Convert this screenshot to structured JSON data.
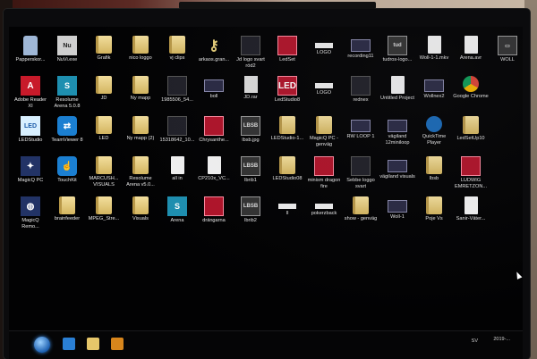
{
  "desktop": {
    "rows": [
      [
        {
          "label": "Papperskor...",
          "icon": "recycle-bin-icon",
          "kind": "k-bin"
        },
        {
          "label": "NuVi.exe",
          "icon": "nuvi-app-icon",
          "kind": "k-nu",
          "glyph": "Nu"
        },
        {
          "label": "Grafik",
          "icon": "folder-icon",
          "kind": "k-folder"
        },
        {
          "label": "nico loggo",
          "icon": "folder-icon",
          "kind": "k-folder"
        },
        {
          "label": "vj clips",
          "icon": "folder-icon",
          "kind": "k-folder"
        },
        {
          "label": "arkaos.gran...",
          "icon": "key-icon",
          "kind": "k-key",
          "glyph": "⚷"
        },
        {
          "label": "Jd logo svart röd2",
          "icon": "logo-image-icon",
          "kind": "k-dark"
        },
        {
          "label": "LedSet",
          "icon": "ledset-app-icon",
          "kind": "k-red"
        },
        {
          "label": "LOGO",
          "icon": "logo-image-icon",
          "kind": "k-bar"
        },
        {
          "label": "recording11",
          "icon": "video-file-icon",
          "kind": "k-vid"
        },
        {
          "label": "tudros-logo...",
          "icon": "logo-image-icon",
          "kind": "k-laser",
          "glyph": "tud"
        },
        {
          "label": "Woll-1-1.mkv",
          "icon": "document-icon",
          "kind": "k-doc"
        },
        {
          "label": "Arena.avr",
          "icon": "document-icon",
          "kind": "k-doc"
        },
        {
          "label": "WOLL",
          "icon": "monitor-image-icon",
          "kind": "k-laser",
          "glyph": "▭"
        }
      ],
      [
        {
          "label": "Adobe Reader XI",
          "icon": "adobe-reader-icon",
          "kind": "k-ps",
          "glyph": "A"
        },
        {
          "label": "Resolume Arena 5.0.8",
          "icon": "resolume-arena-icon",
          "kind": "k-ar",
          "glyph": "S"
        },
        {
          "label": "JD",
          "icon": "folder-icon",
          "kind": "k-folder"
        },
        {
          "label": "Ny mapp",
          "icon": "folder-icon",
          "kind": "k-folder"
        },
        {
          "label": "1985506_54...",
          "icon": "photo-icon",
          "kind": "k-dark"
        },
        {
          "label": "boll",
          "icon": "video-file-icon",
          "kind": "k-vid"
        },
        {
          "label": "JD.rar",
          "icon": "document-icon",
          "kind": "k-file"
        },
        {
          "label": "LedStudio8",
          "icon": "ledstudio-icon",
          "kind": "k-red",
          "glyph": "LED"
        },
        {
          "label": "LOGO",
          "icon": "logo-image-icon",
          "kind": "k-bar"
        },
        {
          "label": "rednex",
          "icon": "photo-icon",
          "kind": "k-dark"
        },
        {
          "label": "Untitled Project",
          "icon": "project-file-icon",
          "kind": "k-doc"
        },
        {
          "label": "Wollnex2",
          "icon": "video-file-icon",
          "kind": "k-vid"
        },
        {
          "label": "Google Chrome",
          "icon": "chrome-icon",
          "kind": "k-chrome"
        }
      ],
      [
        {
          "label": "LEDStudio",
          "icon": "ledstudio-icon",
          "kind": "k-led",
          "glyph": "LED"
        },
        {
          "label": "TeamViewer 8",
          "icon": "teamviewer-icon",
          "kind": "k-tv",
          "glyph": "⇄"
        },
        {
          "label": "LED",
          "icon": "folder-icon",
          "kind": "k-folder"
        },
        {
          "label": "Ny mapp (2)",
          "icon": "folder-icon",
          "kind": "k-folder"
        },
        {
          "label": "15318642_10...",
          "icon": "photo-icon",
          "kind": "k-dark"
        },
        {
          "label": "Chrysanthe...",
          "icon": "photo-icon",
          "kind": "k-red"
        },
        {
          "label": "lbsb.jpg",
          "icon": "photo-icon",
          "kind": "k-laser",
          "glyph": "LBSB"
        },
        {
          "label": "LEDStudio-1...",
          "icon": "folder-icon",
          "kind": "k-folder"
        },
        {
          "label": "MagicQ PC - genväg",
          "icon": "folder-icon",
          "kind": "k-folder"
        },
        {
          "label": "RW LOOP 1",
          "icon": "video-file-icon",
          "kind": "k-vid"
        },
        {
          "label": "vägiland 12miniloop",
          "icon": "video-file-icon",
          "kind": "k-vid"
        },
        {
          "label": "QuickTime Player",
          "icon": "quicktime-icon",
          "kind": "k-qt"
        },
        {
          "label": "LedSetUp10",
          "icon": "folder-icon",
          "kind": "k-folder"
        }
      ],
      [
        {
          "label": "MagicQ PC",
          "icon": "magicq-icon",
          "kind": "k-magic",
          "glyph": "✦"
        },
        {
          "label": "TouchKit",
          "icon": "touchkit-icon",
          "kind": "k-tv",
          "glyph": "☝"
        },
        {
          "label": "MARCUSH... VISUALS",
          "icon": "folder-icon",
          "kind": "k-folder"
        },
        {
          "label": "Resolume Arena v5.0...",
          "icon": "folder-icon",
          "kind": "k-folder"
        },
        {
          "label": "all in",
          "icon": "document-icon",
          "kind": "k-doc"
        },
        {
          "label": "CP210x_VC...",
          "icon": "document-icon",
          "kind": "k-doc"
        },
        {
          "label": "lbrib1",
          "icon": "photo-icon",
          "kind": "k-laser",
          "glyph": "LBSB"
        },
        {
          "label": "LEDStudio08",
          "icon": "folder-icon",
          "kind": "k-folder"
        },
        {
          "label": "minism dragon fire",
          "icon": "video-file-icon",
          "kind": "k-red"
        },
        {
          "label": "Sebbe loggo svart",
          "icon": "photo-icon",
          "kind": "k-dark"
        },
        {
          "label": "vägiland visuals",
          "icon": "video-file-icon",
          "kind": "k-vid"
        },
        {
          "label": "lbsb",
          "icon": "folder-icon",
          "kind": "k-folder"
        },
        {
          "label": "LUDWIG EMRETZON...",
          "icon": "photo-icon",
          "kind": "k-red"
        }
      ],
      [
        {
          "label": "MagicQ Remo...",
          "icon": "magicq-remote-icon",
          "kind": "k-magic",
          "glyph": "◍"
        },
        {
          "label": "brainfeeder",
          "icon": "folder-icon",
          "kind": "k-folder"
        },
        {
          "label": "MPEG_Stre...",
          "icon": "folder-icon",
          "kind": "k-folder"
        },
        {
          "label": "Visuals",
          "icon": "folder-icon",
          "kind": "k-folder"
        },
        {
          "label": "Arena",
          "icon": "resolume-arena-icon",
          "kind": "k-ar",
          "glyph": "S"
        },
        {
          "label": "drängarna",
          "icon": "photo-icon",
          "kind": "k-red"
        },
        {
          "label": "lbrib2",
          "icon": "photo-icon",
          "kind": "k-laser",
          "glyph": "LBSB"
        },
        {
          "label": "II",
          "icon": "image-icon",
          "kind": "k-bar"
        },
        {
          "label": "pokerzback",
          "icon": "image-icon",
          "kind": "k-bar"
        },
        {
          "label": "show - genväg",
          "icon": "folder-icon",
          "kind": "k-folder"
        },
        {
          "label": "Woll-1",
          "icon": "video-file-icon",
          "kind": "k-vid"
        },
        {
          "label": "Poje Vs",
          "icon": "folder-icon",
          "kind": "k-folder"
        },
        {
          "label": "Sanir-Väter...",
          "icon": "document-icon",
          "kind": "k-doc"
        }
      ]
    ]
  },
  "taskbar": {
    "apps": [
      {
        "name": "internet-explorer-icon",
        "color": "#2a7fd4"
      },
      {
        "name": "file-explorer-icon",
        "color": "#e6c66a"
      },
      {
        "name": "media-player-icon",
        "color": "#d8861c"
      }
    ],
    "tray": {
      "lang": "SV",
      "time": "",
      "date": "2019-..."
    }
  }
}
